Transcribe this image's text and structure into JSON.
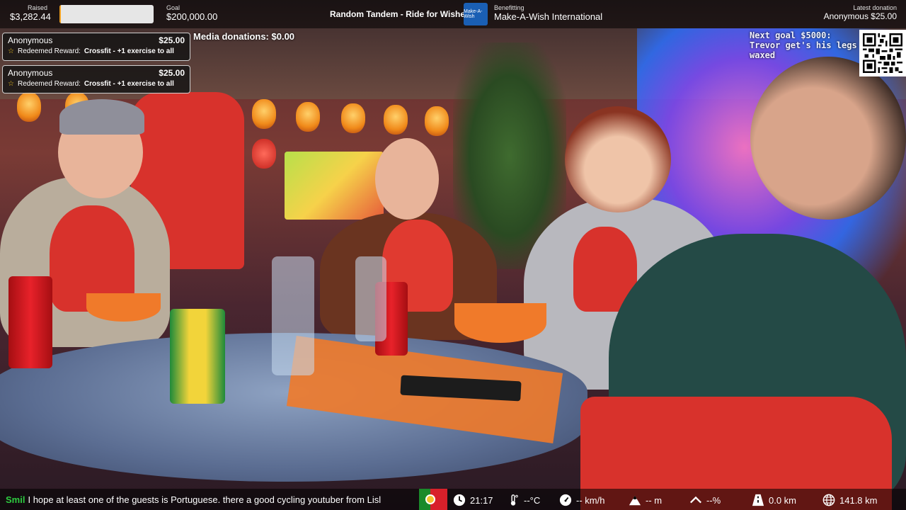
{
  "header": {
    "raised_label": "Raised",
    "raised_value": "$3,282.44",
    "progress_fraction": 0.016,
    "goal_label": "Goal",
    "goal_value": "$200,000.00",
    "event_title": "Random Tandem - Ride for Wishes",
    "logo_text": "Make-A-Wish",
    "benefiting_label": "Benefitting",
    "benefiting_value": "Make-A-Wish International",
    "latest_label": "Latest donation",
    "latest_value": "Anonymous $25.00"
  },
  "alerts": [
    {
      "name": "Anonymous",
      "amount": "$25.00",
      "prefix": "Redeemed Reward:",
      "reward": "Crossfit - +1 exercise to all"
    },
    {
      "name": "Anonymous",
      "amount": "$25.00",
      "prefix": "Redeemed Reward:",
      "reward": "Crossfit - +1 exercise to all"
    }
  ],
  "media_donations": "Media donations: $0.00",
  "next_goal": "Next goal $5000: Trevor get's his legs waxed",
  "ticker": {
    "user": "Smil",
    "message": "I hope at least one of the guests is Portuguese. there a good cycling youtuber from Lisl"
  },
  "stats": {
    "time": "21:17",
    "temperature": "--°C",
    "speed": "-- km/h",
    "elevation": "-- m",
    "grade": "--%",
    "distance": "0.0 km",
    "total_distance": "141.8 km"
  },
  "icons": {
    "flag": "portugal-flag-icon",
    "time": "clock-icon",
    "temperature": "thermometer-icon",
    "speed": "speedometer-icon",
    "elevation": "mountain-icon",
    "grade": "incline-icon",
    "distance": "road-icon",
    "total_distance": "globe-icon"
  },
  "colors": {
    "progress_fill": "#f0a020",
    "ticker_user": "#2ecc40",
    "reward_star": "#f3c623",
    "logo_blue": "#1a5fb4"
  }
}
